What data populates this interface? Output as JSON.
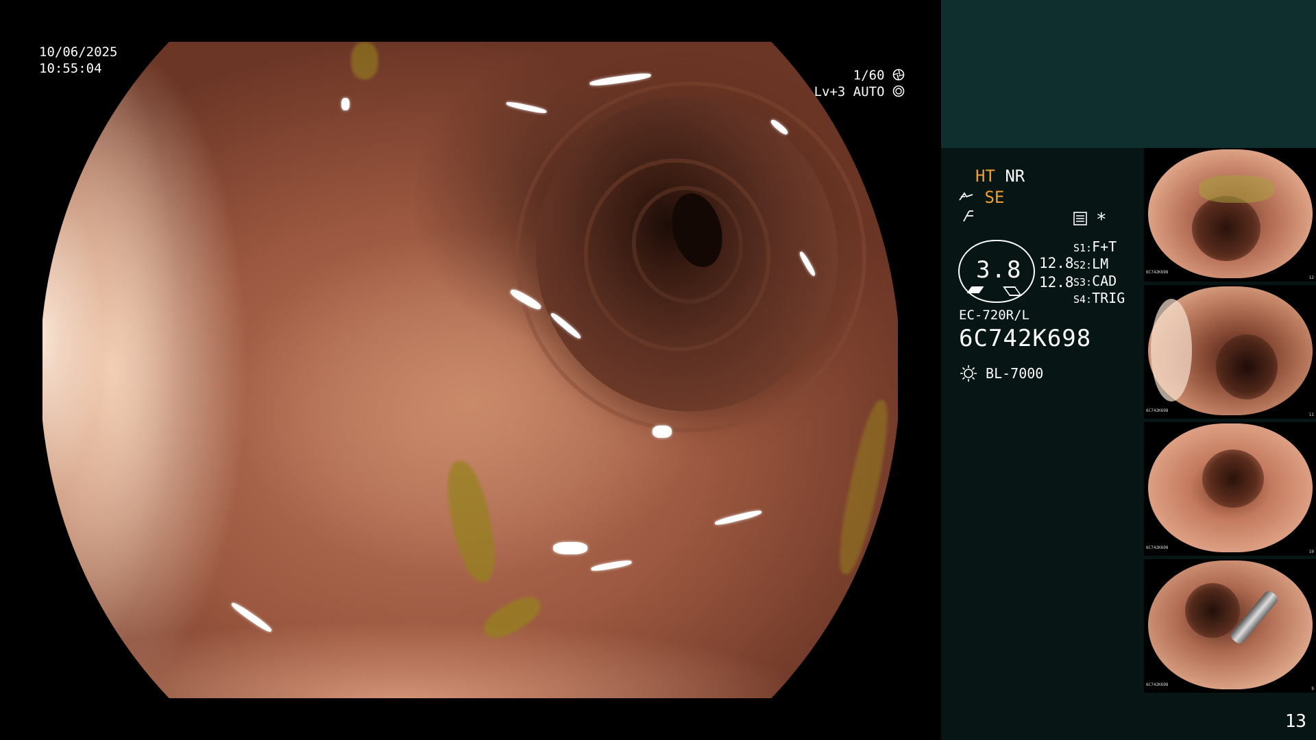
{
  "overlay": {
    "date": "10/06/2025",
    "time": "10:55:04",
    "shutter": "1/60",
    "level": "Lv+3 AUTO"
  },
  "panel": {
    "mode_ht": "HT",
    "mode_nr": "NR",
    "mode_se": "SE",
    "gauge_value": "3.8",
    "gauge_top": "12.8",
    "gauge_bottom": "12.8",
    "slots": [
      {
        "key": "S1:",
        "value": "F+T"
      },
      {
        "key": "S2:",
        "value": "LM"
      },
      {
        "key": "S3:",
        "value": "CAD"
      },
      {
        "key": "S4:",
        "value": "TRIG"
      }
    ],
    "scope_model": "EC-720R/L",
    "scope_serial": "6C742K698",
    "light_source": "BL-7000",
    "star": "*"
  },
  "thumbnails": [
    {
      "serial": "6C742K698",
      "index": "12"
    },
    {
      "serial": "6C742K698",
      "index": "11"
    },
    {
      "serial": "6C742K698",
      "index": "10"
    },
    {
      "serial": "6C742K698",
      "index": "9"
    }
  ],
  "page_number": "13",
  "colors": {
    "accent_orange": "#f0a030",
    "panel_top": "#0e2f2e",
    "panel_main": "#071614"
  },
  "icons": [
    "shutter-icon",
    "auto-iris-icon",
    "structure-enhance-icon",
    "filter-icon",
    "record-icon",
    "light-source-icon"
  ]
}
